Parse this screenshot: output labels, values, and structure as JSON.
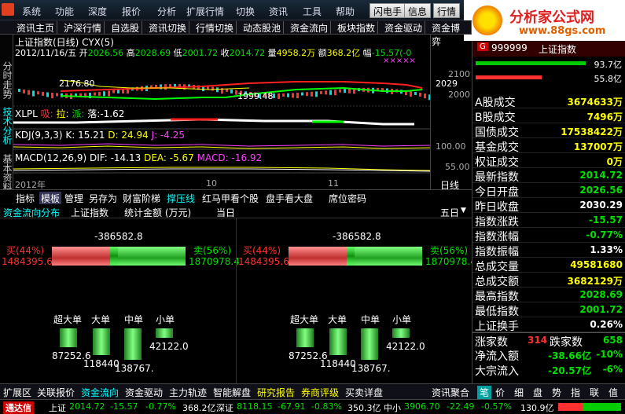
{
  "menu": {
    "items": [
      "系统",
      "功能",
      "深度",
      "报价",
      "分析",
      "扩展行情",
      "切换",
      "资讯",
      "工具",
      "帮助"
    ],
    "buttons": [
      "闪电手",
      "信息",
      "行情"
    ]
  },
  "brand": {
    "name": "分析家公式网",
    "url": "www.88gs.com"
  },
  "tabs": [
    "资讯主页",
    "沪深行情",
    "自选股",
    "资讯切换",
    "行情切换",
    "动态股池",
    "资金流向",
    "板块指数",
    "资金驱动",
    "资金博弈"
  ],
  "side_tabs": [
    "分时走势",
    "技术分析",
    "基本资料"
  ],
  "chart_header": {
    "title": "上证指数(日线) CYX(5)",
    "date": "2012/11/16/五",
    "open_label": "开",
    "open": "2026.56",
    "high_label": "高",
    "high": "2028.69",
    "low_label": "低",
    "low": "2001.72",
    "close_label": "收",
    "close": "2014.72",
    "vol_label": "量",
    "vol": "4958.2万",
    "amt_label": "额",
    "amt": "368.2亿",
    "amp_label": "幅",
    "amp": "-15.57(-0"
  },
  "main_chart": {
    "high_mark": "2176.80",
    "low_mark": "1999.48",
    "last_mark": "2029",
    "axis": [
      "2100",
      "2000"
    ]
  },
  "xlpl": {
    "name": "XLPL",
    "buy_label": "吸:",
    "pull_label": "拉:",
    "send_label": "派:",
    "fall_label": "落:",
    "fall": "-1.62"
  },
  "kdj": {
    "name": "KDJ(9,3,3)",
    "k": "K: 15.21",
    "d": "D: 24.94",
    "j": "J: -4.25",
    "axis": "100.00"
  },
  "macd": {
    "name": "MACD(12,26,9)",
    "dif": "DIF: -14.13",
    "dea": "DEA: -5.67",
    "macd": "MACD: -16.92",
    "axis": "55.00"
  },
  "time_axis": {
    "year": "2012年",
    "m10": "10",
    "m11": "11",
    "period": "日线"
  },
  "sub_tabs": [
    "指标",
    "模板",
    "管理",
    "另存为",
    "财富阶梯",
    "撑压线",
    "红马甲看个股",
    "盘手看大盘",
    "席位密码"
  ],
  "fund_head": {
    "left": "资金流向分布",
    "index": "上证指数",
    "stat": "统计金额 (万元)",
    "today": "当日",
    "five": "五日"
  },
  "flow": {
    "net": "-386582.8",
    "buy_label": "买(44%)",
    "buy": "1484395.6",
    "sell_label": "卖(56%)",
    "sell": "1870978.4",
    "bar_labels": [
      "超大单",
      "大单",
      "中单",
      "小单"
    ],
    "bar_values": [
      "87252.6",
      "118440",
      "138767.",
      "42122.0"
    ]
  },
  "flow5": {
    "net": "-386582.8",
    "buy_label": "买(44%)",
    "buy": "1484395.6",
    "sell_label": "卖(56%)",
    "sell": "1870978.4",
    "bar_labels": [
      "超大单",
      "大单",
      "中单",
      "小单"
    ],
    "bar_values": [
      "87252.6",
      "118440",
      "138767.",
      "42122.0"
    ]
  },
  "right_top": {
    "code": "999999",
    "name": "上证指数",
    "pct1": "93.7亿",
    "pct2": "55.8亿"
  },
  "right_rows": [
    {
      "label": "A股成交",
      "value": "3674633万",
      "color": "yellow"
    },
    {
      "label": "B股成交",
      "value": "7496万",
      "color": "yellow"
    },
    {
      "label": "国债成交",
      "value": "17538422万",
      "color": "yellow"
    },
    {
      "label": "基金成交",
      "value": "137007万",
      "color": "yellow"
    },
    {
      "label": "权证成交",
      "value": "0万",
      "color": "yellow"
    },
    {
      "label": "最新指数",
      "value": "2014.72",
      "color": "green"
    },
    {
      "label": "今日开盘",
      "value": "2026.56",
      "color": "green"
    },
    {
      "label": "昨日收盘",
      "value": "2030.29",
      "color": "white"
    },
    {
      "label": "指数涨跌",
      "value": "-15.57",
      "color": "green"
    },
    {
      "label": "指数涨幅",
      "value": "-0.77%",
      "color": "green"
    },
    {
      "label": "指数振幅",
      "value": "1.33%",
      "color": "white"
    },
    {
      "label": "总成交量",
      "value": "49581680",
      "color": "yellow"
    },
    {
      "label": "总成交额",
      "value": "3682129万",
      "color": "yellow"
    },
    {
      "label": "最高指数",
      "value": "2028.69",
      "color": "green"
    },
    {
      "label": "最低指数",
      "value": "2001.72",
      "color": "green"
    },
    {
      "label": "上证换手",
      "value": "0.26%",
      "color": "white"
    }
  ],
  "updown": {
    "up_label": "涨家数",
    "up": "314",
    "down_label": "跌家数",
    "down": "658"
  },
  "netflow": [
    {
      "label": "净流入额",
      "value": "-38.66亿",
      "pct": "-10%"
    },
    {
      "label": "大宗流入",
      "value": "-20.57亿",
      "pct": "-6%"
    }
  ],
  "bottom_tabs": [
    "扩展区",
    "关联报价",
    "资金流向",
    "资金驱动",
    "主力轨迹",
    "智能解盘",
    "研究报告",
    "券商评级",
    "买卖详盘"
  ],
  "bottom_right_tabs": [
    "资讯聚合",
    "笔",
    "价",
    "细",
    "盘",
    "势",
    "指",
    "联",
    "值"
  ],
  "status": {
    "logo": "通达信",
    "sh_label": "上证",
    "sh": "2014.72",
    "sh_chg": "-15.57",
    "sh_pct": "-0.77%",
    "sh_amt": "368.2亿",
    "sz_label": "深证",
    "sz": "8118.15",
    "sz_chg": "-67.91",
    "sz_pct": "-0.83%",
    "sz_amt": "350.3亿",
    "zx_label": "中小",
    "zx": "3906.70",
    "zx_chg": "-22.49",
    "zx_pct": "-0.57%",
    "zx_amt": "130.9亿"
  }
}
